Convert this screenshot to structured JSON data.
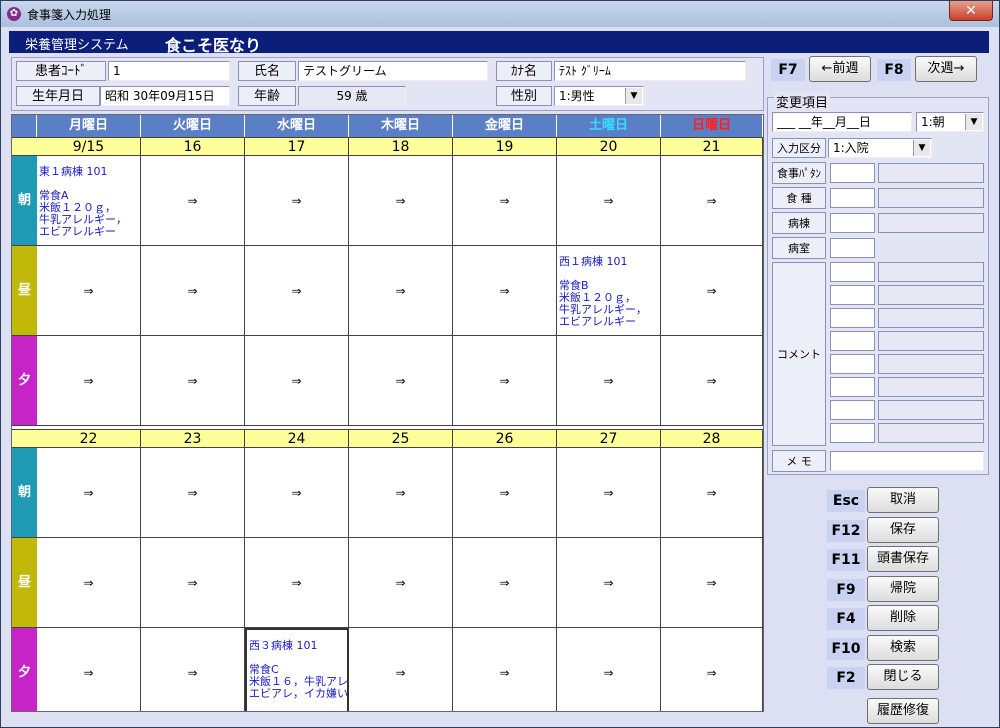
{
  "window": {
    "title": "食事箋入力処理",
    "close_label": "✕"
  },
  "brand": {
    "system": "栄養管理システム",
    "name": "食こそ医なり"
  },
  "patient": {
    "code_label": "患者ｺｰﾄﾞ",
    "code_value": "1",
    "name_label": "氏名",
    "name_value": "テストグリーム",
    "kana_label": "ｶﾅ名",
    "kana_value": "ﾃｽﾄ ｸﾞﾘｰﾑ",
    "dob_label": "生年月日",
    "dob_value": "昭和 30年09月15日",
    "age_label": "年齢",
    "age_value": "59 歳",
    "sex_label": "性別",
    "sex_value": "1:男性"
  },
  "nav": {
    "prev_key": "F7",
    "prev_label": "←前週",
    "next_key": "F8",
    "next_label": "次週→"
  },
  "calendar": {
    "days": [
      "月曜日",
      "火曜日",
      "水曜日",
      "木曜日",
      "金曜日",
      "土曜日",
      "日曜日"
    ],
    "day_colors": [
      "#ffffff",
      "#ffffff",
      "#ffffff",
      "#ffffff",
      "#ffffff",
      "#33ddff",
      "#ff2020"
    ],
    "weeks": [
      {
        "dates": [
          "9/15",
          "16",
          "17",
          "18",
          "19",
          "20",
          "21"
        ]
      },
      {
        "dates": [
          "22",
          "23",
          "24",
          "25",
          "26",
          "27",
          "28"
        ]
      }
    ],
    "meals": [
      "朝",
      "昼",
      "夕"
    ],
    "meal_colors": [
      "#1f9ab5",
      "#c2b80a",
      "#c624c6"
    ],
    "arrow": "⇒",
    "entries": {
      "w0_m0_d0": [
        "東１病棟 101",
        "",
        "常食A",
        "米飯１２０ｇ，",
        "牛乳アレルギー，",
        "エビアレルギー"
      ],
      "w0_m1_d5": [
        "西１病棟 101",
        "",
        "常食B",
        "米飯１２０ｇ，",
        "牛乳アレルギー，",
        "エビアレルギー"
      ],
      "w1_m2_d2": [
        "西３病棟 101",
        "",
        "常食C",
        "米飯１６，牛乳アレ",
        "エビアレ，イカ嫌い"
      ]
    }
  },
  "change": {
    "title": "変更項目",
    "date_value": "___ __年__月__日",
    "meal_value": "1:朝",
    "input_label": "入力区分",
    "input_value": "1:入院",
    "fields": [
      "食事ﾊﾟﾀﾝ",
      "食 種",
      "病棟",
      "病室"
    ],
    "comment_label": "コメント",
    "memo_label": "メ モ"
  },
  "actions": [
    {
      "key": "Esc",
      "label": "取消"
    },
    {
      "key": "F12",
      "label": "保存"
    },
    {
      "key": "F11",
      "label": "頭書保存"
    },
    {
      "key": "F9",
      "label": "帰院"
    },
    {
      "key": "F4",
      "label": "削除"
    },
    {
      "key": "F10",
      "label": "検索"
    },
    {
      "key": "F2",
      "label": "閉じる"
    }
  ],
  "history_label": "履歴修復"
}
